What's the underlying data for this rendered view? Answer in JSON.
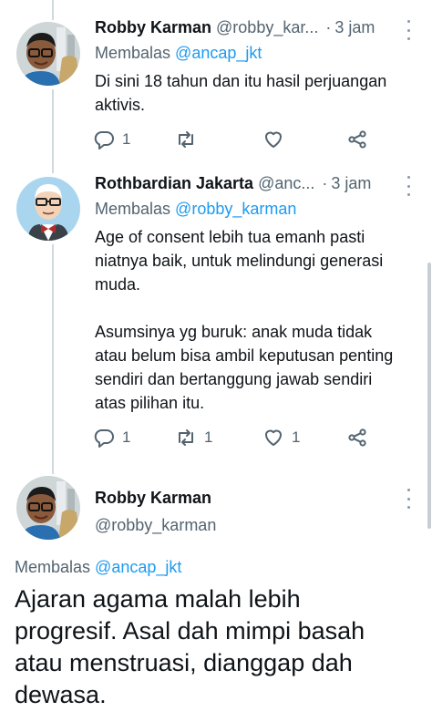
{
  "tweets": [
    {
      "author": {
        "name": "Robby Karman",
        "handle": "@robby_kar..."
      },
      "time": "3 jam",
      "separator": "·",
      "reply_prefix": "Membalas",
      "reply_to": "@ancap_jkt",
      "text": [
        "Di sini 18 tahun dan itu hasil perjuangan aktivis."
      ],
      "stats": {
        "replies": "1",
        "retweets": "",
        "likes": ""
      }
    },
    {
      "author": {
        "name": "Rothbardian Jakarta",
        "handle": "@anc..."
      },
      "time": "3 jam",
      "separator": "·",
      "reply_prefix": "Membalas",
      "reply_to": "@robby_karman",
      "text": [
        "Age of consent lebih tua emanh pasti niatnya baik, untuk melindungi generasi muda.",
        "Asumsinya yg buruk: anak muda tidak atau belum bisa ambil keputusan penting sendiri dan bertanggung jawab sendiri atas pilihan itu."
      ],
      "stats": {
        "replies": "1",
        "retweets": "1",
        "likes": "1"
      }
    }
  ],
  "focused_tweet": {
    "author": {
      "name": "Robby Karman",
      "handle": "@robby_karman"
    },
    "reply_prefix": "Membalas",
    "reply_to": "@ancap_jkt",
    "text_lines": [
      "Ajaran agama malah lebih",
      "progresif. Asal dah mimpi basah",
      "atau menstruasi, dianggap dah",
      "dewasa."
    ]
  },
  "icons": {
    "reply": "reply-icon",
    "retweet": "retweet-icon",
    "like": "heart-icon",
    "share": "share-icon",
    "more": "more-vertical-icon"
  },
  "colors": {
    "text": "#0f1419",
    "secondary": "#536471",
    "link": "#1d9bf0",
    "thread_line": "#cfd9de"
  }
}
